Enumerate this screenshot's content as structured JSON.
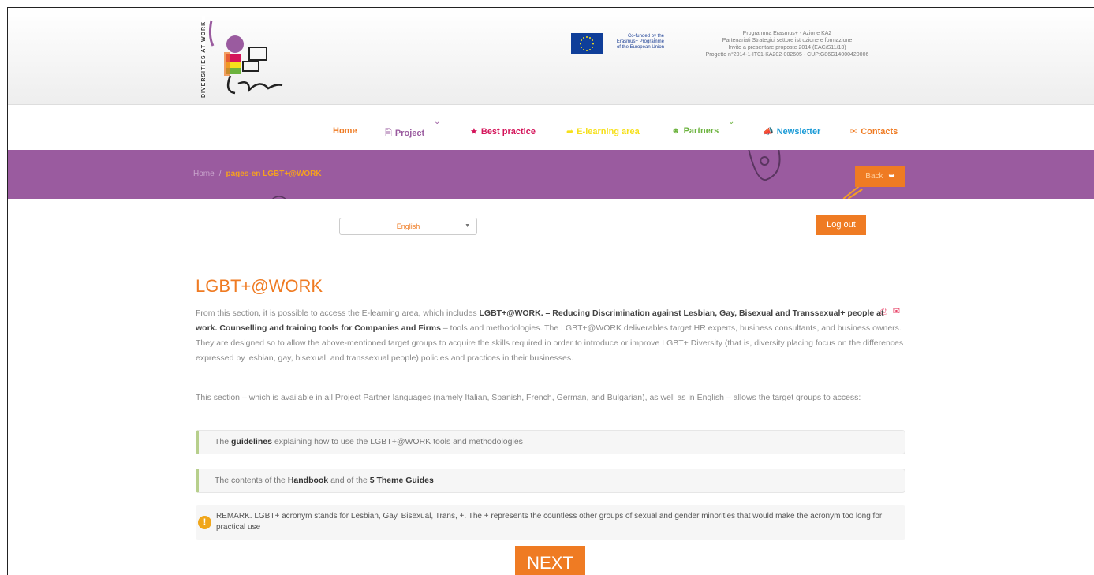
{
  "header": {
    "logo_text": "DIVERSITIES AT WORK d@Work",
    "eu_text": [
      "Co-funded by the",
      "Erasmus+ Programme",
      "of the European Union"
    ],
    "program_lines": [
      "Programma Erasmus+ - Azione KA2",
      "Partenariati Strategici settore istruzione e formazione",
      "Invito a presentare proposte 2014 (EAC/S11/13)",
      "Progetto n°2014-1-IT01-KA202-002605 - CUP:G86G14000420006"
    ]
  },
  "nav": {
    "items": [
      {
        "label": "Home",
        "icon": "",
        "color": "#ef7b23"
      },
      {
        "label": "Project",
        "icon": "document-icon",
        "color": "#9a5b9f"
      },
      {
        "label": "Best practice",
        "icon": "star-icon",
        "color": "#d4145a"
      },
      {
        "label": "E-learning area",
        "icon": "share-arrow-icon",
        "color": "#f6e01c"
      },
      {
        "label": "Partners",
        "icon": "group-icon",
        "color": "#6cb33e"
      },
      {
        "label": "Newsletter",
        "icon": "megaphone-icon",
        "color": "#1a9ad6"
      },
      {
        "label": "Contacts",
        "icon": "envelope-icon",
        "color": "#ef7b23"
      }
    ]
  },
  "breadcrumb": {
    "home": "Home",
    "separator": "/",
    "current": "pages-en LGBT+@WORK"
  },
  "back_button": "Back",
  "language_select": {
    "value": "English"
  },
  "logout": "Log out",
  "page": {
    "title": "LGBT+@WORK",
    "para1": {
      "pre": "From this section, it is possible to access the E-learning area, which includes ",
      "bold": "LGBT+@WORK. – Reducing Discrimination against Lesbian, Gay, Bisexual and Transsexual+ people at work. Counselling and training tools for Companies and Firms",
      "post": " – tools and methodologies. The LGBT+@WORK deliverables target HR experts, business consultants, and business owners. They are designed so to allow the above-mentioned target groups to acquire the skills required in order to introduce or improve LGBT+ Diversity (that is, diversity placing focus on the differences expressed by lesbian, gay, bisexual, and transsexual people) policies and practices in their businesses."
    },
    "para2": "This section – which is available in all Project Partner languages (namely Italian, Spanish, French, German, and Bulgarian), as well as in English – allows the target groups to access:",
    "box1": {
      "pre": "The ",
      "bold": "guidelines",
      "post": " explaining how to use the LGBT+@WORK tools and methodologies"
    },
    "box2": {
      "pre": "The contents of the ",
      "bold1": "Handbook",
      "mid": " and of the ",
      "bold2": "5 Theme Guides"
    },
    "remark": "REMARK. LGBT+ acronym stands for Lesbian, Gay, Bisexual, Trans, +. The + represents the countless other groups of sexual and gender minorities that would make the acronym too long for practical use",
    "next": "NEXT"
  }
}
